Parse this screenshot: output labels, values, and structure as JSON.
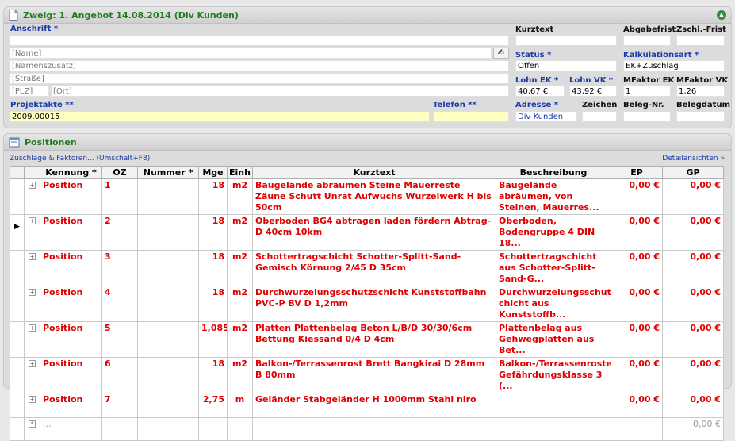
{
  "header_panel": {
    "title": "Zweig: 1. Angebot 14.08.2014 (Div Kunden)",
    "anschrift_label": "Anschrift *",
    "name_placeholder": "[Name]",
    "namenszusatz_placeholder": "[Namenszusatz]",
    "strasse_placeholder": "[Straße]",
    "plz_placeholder": "[PLZ]",
    "ort_placeholder": "[Ort]",
    "projektakte_label": "Projektakte **",
    "projektakte_value": "2009.00015",
    "telefon_label": "Telefon **",
    "telefon_value": "",
    "kurztext_label": "Kurztext",
    "abgabefrist_label": "Abgabefrist",
    "zschl_label": "Zschl.-Frist",
    "status_label": "Status *",
    "status_value": "Offen",
    "kalkulationsart_label": "Kalkulationsart *",
    "kalkulationsart_value": "EK+Zuschlag",
    "lohn_ek_label": "Lohn EK *",
    "lohn_ek_value": "40,67 €",
    "lohn_vk_label": "Lohn VK *",
    "lohn_vk_value": "43,92 €",
    "mfaktor_ek_label": "MFaktor EK",
    "mfaktor_ek_value": "1",
    "mfaktor_vk_label": "MFaktor VK",
    "mfaktor_vk_value": "1,26",
    "adresse_label": "Adresse *",
    "adresse_value": "Div Kunden",
    "zeichen_label": "Zeichen",
    "belegnr_label": "Beleg-Nr.",
    "belegdatum_label": "Belegdatum"
  },
  "positions_panel": {
    "title": "Positionen",
    "zuschlaege_link": "Zuschläge & Faktoren... (Umschalt+F8)",
    "detail_link": "Detailansichten »",
    "columns": [
      "Kennung *",
      "OZ",
      "Nummer *",
      "Mge",
      "Einh",
      "Kurztext",
      "Beschreibung",
      "EP",
      "GP"
    ],
    "rows": [
      {
        "kennung": "Position",
        "oz": "1",
        "nummer": "",
        "mge": "18",
        "einh": "m2",
        "kurztext": "Baugelände abräumen Steine Mauerreste Zäune Schutt Unrat Aufwuchs Wurzelwerk H bis 50cm",
        "beschreibung": "Baugelände abräumen, von Steinen, Mauerres...",
        "ep": "0,00 €",
        "gp": "0,00 €"
      },
      {
        "kennung": "Position",
        "oz": "2",
        "nummer": "",
        "mge": "18",
        "einh": "m2",
        "kurztext": "Oberboden BG4 abtragen laden fördern Abtrag-D 40cm 10km",
        "beschreibung": "Oberboden, Bodengruppe 4 DIN 18...",
        "ep": "0,00 €",
        "gp": "0,00 €"
      },
      {
        "kennung": "Position",
        "oz": "3",
        "nummer": "",
        "mge": "18",
        "einh": "m2",
        "kurztext": "Schottertragschicht Schotter-Splitt-Sand-Gemisch Körnung 2/45 D 35cm",
        "beschreibung": "Schottertragschicht aus Schotter-Splitt-Sand-G...",
        "ep": "0,00 €",
        "gp": "0,00 €"
      },
      {
        "kennung": "Position",
        "oz": "4",
        "nummer": "",
        "mge": "18",
        "einh": "m2",
        "kurztext": "Durchwurzelungsschutzschicht Kunststoffbahn PVC-P BV D 1,2mm",
        "beschreibung": "Durchwurzelungsschutzs chicht aus Kunststoffb...",
        "ep": "0,00 €",
        "gp": "0,00 €"
      },
      {
        "kennung": "Position",
        "oz": "5",
        "nummer": "",
        "mge": "1,085",
        "einh": "m2",
        "kurztext": "Platten Plattenbelag Beton L/B/D 30/30/6cm Bettung Kiessand 0/4 D 4cm",
        "beschreibung": "Plattenbelag aus Gehwegplatten aus Bet...",
        "ep": "0,00 €",
        "gp": "0,00 €"
      },
      {
        "kennung": "Position",
        "oz": "6",
        "nummer": "",
        "mge": "18",
        "einh": "m2",
        "kurztext": "Balkon-/Terrassenrost Brett Bangkirai D 28mm B 80mm",
        "beschreibung": "Balkon-/Terrassenroste, Gefährdungsklasse 3 (...",
        "ep": "0,00 €",
        "gp": "0,00 €"
      },
      {
        "kennung": "Position",
        "oz": "7",
        "nummer": "",
        "mge": "2,75",
        "einh": "m",
        "kurztext": "Geländer Stabgeländer H 1000mm Stahl niro",
        "beschreibung": "",
        "ep": "0,00 €",
        "gp": "0,00 €"
      }
    ],
    "new_row_kennung": "...",
    "total_gp": "0,00 €"
  }
}
